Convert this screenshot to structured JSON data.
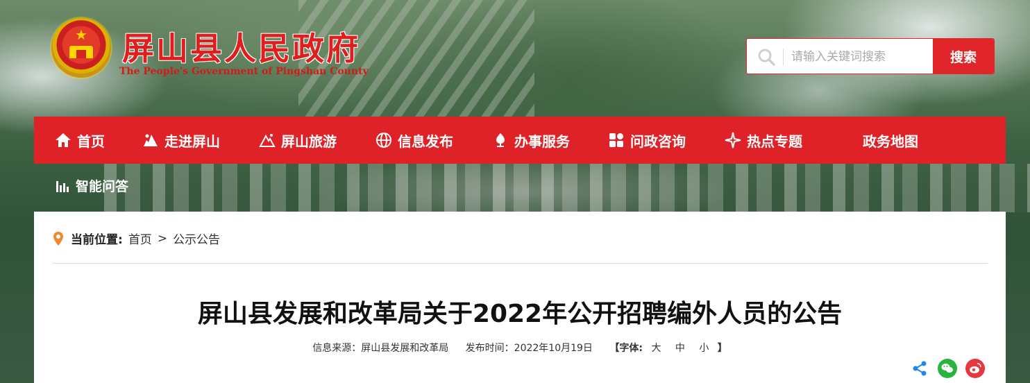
{
  "header": {
    "site_title": "屏山县人民政府",
    "site_subtitle": "The People's Government of Pingshan County"
  },
  "search": {
    "placeholder": "请输入关键词搜索",
    "button_label": "搜索"
  },
  "nav": {
    "items": [
      {
        "label": "首页",
        "icon": "home-icon"
      },
      {
        "label": "走进屏山",
        "icon": "mountain-icon"
      },
      {
        "label": "屏山旅游",
        "icon": "travel-icon"
      },
      {
        "label": "信息发布",
        "icon": "globe-icon"
      },
      {
        "label": "办事服务",
        "icon": "service-icon"
      },
      {
        "label": "问政咨询",
        "icon": "grid-icon"
      },
      {
        "label": "热点专题",
        "icon": "star-icon"
      },
      {
        "label": "政务地图",
        "icon": ""
      }
    ],
    "second_row": {
      "label": "智能问答",
      "icon": "bar-chart-icon"
    }
  },
  "breadcrumb": {
    "label": "当前位置:",
    "home": "首页",
    "separator": ">",
    "current": "公示公告"
  },
  "article": {
    "title": "屏山县发展和改革局关于2022年公开招聘编外人员的公告",
    "source_label": "信息来源：屏山县发展和改革局",
    "date_label": "发布时间：2022年10月19日",
    "font_open": "【字体:",
    "font_large": "大",
    "font_medium": "中",
    "font_small": "小",
    "font_close": "】"
  },
  "share": {
    "icons": [
      "share-icon",
      "wechat-icon",
      "weibo-icon"
    ]
  },
  "colors": {
    "brand_red": "#df2228",
    "title_red": "#e01e1e",
    "wechat_green": "#29b340",
    "weibo_red": "#e6383e",
    "share_blue": "#1e88e5",
    "location_orange": "#f08a2e"
  }
}
